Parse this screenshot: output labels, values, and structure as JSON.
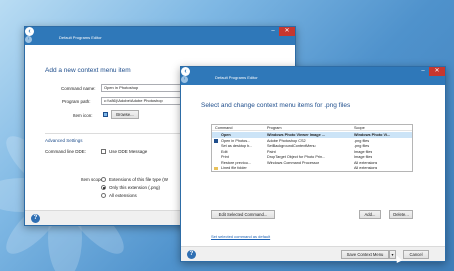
{
  "back_window": {
    "title": "Default Programs Editor",
    "heading": "Add a new context menu item",
    "command_name_label": "Command name:",
    "command_name_value": "Open in Photoshop",
    "program_path_label": "Program path:",
    "program_path_value": "c:\\\\x86)\\Adobe\\Adobe Photoshop",
    "item_icon_label": "Item icon:",
    "browse_label": "Browse...",
    "advanced_label": "Advanced Settings",
    "cmdline_dde_label": "Command line DDE:",
    "use_dde_label": "Use DDE Message",
    "item_scope_label": "Item scope:",
    "scope_options": [
      {
        "label": "Extensions of this file type (W",
        "selected": false
      },
      {
        "label": "Only this extension (.png)",
        "selected": true
      },
      {
        "label": "All extensions",
        "selected": false
      }
    ]
  },
  "front_window": {
    "title": "Default Programs Editor",
    "heading": "Select and change context menu items for .png files",
    "columns": [
      "Command",
      "Program",
      "Scope"
    ],
    "rows": [
      {
        "command": "Open",
        "program": "Windows Photo Viewer Image ...",
        "scope": "Windows Photo Vi...",
        "bold": true,
        "selected": true,
        "icon": false
      },
      {
        "command": "Open in Photos...",
        "program": "Adobe Photoshop CS2",
        "scope": ".png files",
        "bold": false,
        "selected": false,
        "icon": true
      },
      {
        "command": "Set as desktop b...",
        "program": "SetBackgroundContextMenu",
        "scope": ".png files",
        "bold": false,
        "selected": false,
        "icon": false
      },
      {
        "command": "Edit",
        "program": "Paint",
        "scope": "Image files",
        "bold": false,
        "selected": false,
        "icon": false
      },
      {
        "command": "Print",
        "program": "DropTarget Object for Photo Prin...",
        "scope": "Image files",
        "bold": false,
        "selected": false,
        "icon": false
      },
      {
        "command": "Restore previou...",
        "program": "Windows Command Processor",
        "scope": "All extensions",
        "bold": false,
        "selected": false,
        "icon": false
      },
      {
        "command": "Lined file folder",
        "program": "",
        "scope": "All extensions",
        "bold": false,
        "selected": false,
        "icon": false
      }
    ],
    "edit_selected_label": "Edit Selected Command...",
    "add_label": "Add...",
    "delete_label": "Delete...",
    "reset_link": "Set selected command as default",
    "save_label": "Save Context Menu",
    "cancel_label": "Cancel"
  },
  "colors": {
    "titlebar": "#2f78b9",
    "close": "#c7372f",
    "accent_text": "#1f4e8c",
    "link": "#1e63b5",
    "selection": "#cce4f7"
  }
}
